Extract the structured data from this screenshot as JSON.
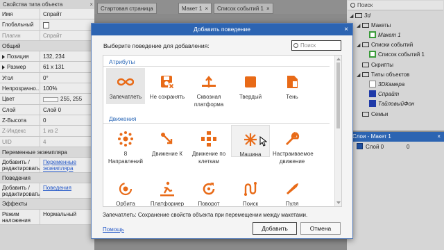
{
  "properties_panel": {
    "title": "Свойства типа объекта",
    "rows": [
      {
        "key": "Имя",
        "value": "Спрайт"
      },
      {
        "key": "Глобальный",
        "value": ""
      },
      {
        "key": "Плагин",
        "value": "Спрайт"
      },
      {
        "header": "Общий"
      },
      {
        "key": "Позиция",
        "value": "132,  234"
      },
      {
        "key": "Размер",
        "value": "61 x 131"
      },
      {
        "key": "Угол",
        "value": "0°"
      },
      {
        "key": "Непрозрачно...",
        "value": "100%"
      },
      {
        "key": "Цвет",
        "value": "255, 255"
      },
      {
        "key": "Слой",
        "value": "Слой 0"
      },
      {
        "key": "Z-Высота",
        "value": "0"
      },
      {
        "key": "Z-Индекс",
        "value": "1 из 2"
      },
      {
        "key": "UID",
        "value": "4"
      },
      {
        "header": "Переменные экземпляра"
      },
      {
        "key": "Добавить / редактировать",
        "value": "Переменные экземпляра"
      },
      {
        "header": "Поведения"
      },
      {
        "key": "Добавить / редактировать",
        "value": "Поведения"
      },
      {
        "header": "Эффекты"
      },
      {
        "key": "Режим наложения",
        "value": "Нормальный"
      }
    ],
    "close_glyph": "×"
  },
  "tabs": [
    {
      "label": "Стартовая страница",
      "active": false
    },
    {
      "label": "Макет 1",
      "active": true,
      "close": "×"
    },
    {
      "label": "Список событий 1",
      "active": false,
      "close": "×"
    }
  ],
  "project_panel": {
    "search_placeholder": "Поиск",
    "tree": [
      {
        "label": "3d",
        "italic": true,
        "kind": "folder"
      },
      {
        "label": "Макеты",
        "kind": "folder"
      },
      {
        "label": "Макет 1",
        "italic": true,
        "kind": "layout-icon"
      },
      {
        "label": "Списки событий",
        "kind": "folder"
      },
      {
        "label": "Список событий 1",
        "kind": "eventsheet-icon"
      },
      {
        "label": "Скрипты",
        "kind": "folder"
      },
      {
        "label": "Типы объектов",
        "kind": "folder"
      },
      {
        "label": "3DКамера",
        "italic": true,
        "kind": "camera-icon"
      },
      {
        "label": "Спрайт",
        "italic": true,
        "kind": "sprite-icon"
      },
      {
        "label": "ТайловыйФон",
        "italic": true,
        "kind": "tiled-icon"
      },
      {
        "label": "Семьи",
        "kind": "folder"
      }
    ],
    "layers_title": "Слои - Макет 1",
    "layers": [
      {
        "label": "Слой 0",
        "value": "0"
      }
    ]
  },
  "dialog": {
    "title": "Добавить поведение",
    "close_glyph": "×",
    "prompt": "Выберите поведение для добавления:",
    "search_placeholder": "Поиск",
    "categories": [
      {
        "name": "Атрибуты",
        "items": [
          {
            "label": "Запечатлеть",
            "icon": "persist-icon",
            "selected": true
          },
          {
            "label": "Не сохранять",
            "icon": "no-save-icon"
          },
          {
            "label": "Сквозная платформа",
            "icon": "jumpthru-icon"
          },
          {
            "label": "Твердый",
            "icon": "solid-icon"
          },
          {
            "label": "Тень",
            "icon": "shadow-caster-icon"
          }
        ]
      },
      {
        "name": "Движения",
        "items": [
          {
            "label": "8 Направлений",
            "icon": "eight-direction-icon"
          },
          {
            "label": "Движение К",
            "icon": "move-to-icon"
          },
          {
            "label": "Движение по клеткам",
            "icon": "tile-movement-icon"
          },
          {
            "label": "Машина",
            "icon": "car-icon",
            "hover": true
          },
          {
            "label": "Настраиваемое движение",
            "icon": "custom-movement-icon"
          },
          {
            "label": "Орбита",
            "icon": "orbit-icon"
          },
          {
            "label": "Платформер",
            "icon": "platform-icon"
          },
          {
            "label": "Поворот",
            "icon": "rotate-icon"
          },
          {
            "label": "Поиск",
            "icon": "pathfinding-icon"
          },
          {
            "label": "Пуля",
            "icon": "bullet-icon"
          }
        ]
      }
    ],
    "description": "Запечатлеть: Сохранение свойств объекта при перемещении между макетами.",
    "help_label": "Помощь",
    "add_label": "Добавить",
    "cancel_label": "Отмена",
    "accent_color": "#e86a17",
    "title_bar_color": "#2c64b2"
  }
}
